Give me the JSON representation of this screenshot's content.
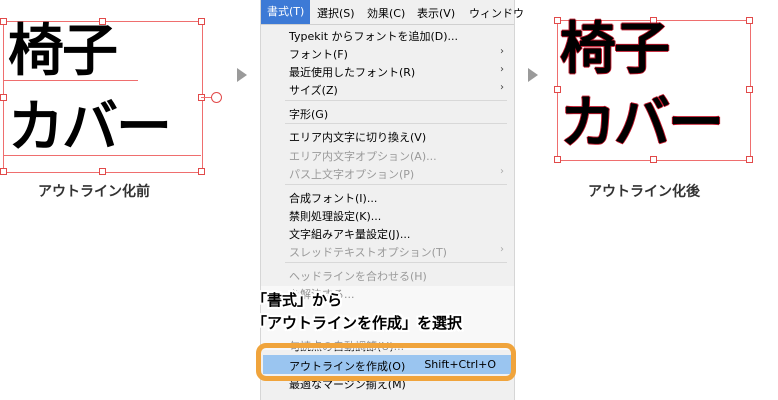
{
  "before": {
    "line1": "椅子",
    "line2": "カバー",
    "caption": "アウトライン化前"
  },
  "after": {
    "line1": "椅子",
    "line2": "カバー",
    "caption": "アウトライン化後"
  },
  "colors": {
    "selection": "#ef6e6e",
    "highlight": "#9ac5f0",
    "callout": "#f0a43c",
    "arrow": "#9a9a9a"
  },
  "menubar": [
    "書式(T)",
    "選択(S)",
    "効果(C)",
    "表示(V)",
    "ウィンドウ"
  ],
  "menu": [
    {
      "label": "Typekit からフォントを追加(D)...",
      "disabled": false,
      "submenu": false
    },
    {
      "label": "フォント(F)",
      "disabled": false,
      "submenu": true
    },
    {
      "label": "最近使用したフォント(R)",
      "disabled": false,
      "submenu": true
    },
    {
      "label": "サイズ(Z)",
      "disabled": false,
      "submenu": true
    },
    {
      "label": "字形(G)",
      "disabled": false,
      "submenu": false
    },
    {
      "label": "エリア内文字に切り換え(V)",
      "disabled": false,
      "submenu": false
    },
    {
      "label": "エリア内文字オプション(A)...",
      "disabled": true,
      "submenu": false
    },
    {
      "label": "パス上文字オプション(P)",
      "disabled": true,
      "submenu": true
    },
    {
      "label": "合成フォント(I)...",
      "disabled": false,
      "submenu": false
    },
    {
      "label": "禁則処理設定(K)...",
      "disabled": false,
      "submenu": false
    },
    {
      "label": "文字組みアキ量設定(J)...",
      "disabled": false,
      "submenu": false
    },
    {
      "label": "スレッドテキストオプション(T)",
      "disabled": true,
      "submenu": true
    },
    {
      "label": "ヘッドラインを合わせる(H)",
      "disabled": true,
      "submenu": false
    },
    {
      "label": "を解決する...",
      "disabled": false,
      "submenu": false
    },
    {
      "label": "句読点の自動調節(U)...",
      "disabled": false,
      "submenu": false
    },
    {
      "label": "アウトラインを作成(O)",
      "disabled": false,
      "submenu": false,
      "shortcut": "Shift+Ctrl+O",
      "highlighted": true
    },
    {
      "label": "最適なマージン揃え(M)",
      "disabled": false,
      "submenu": false
    }
  ],
  "annotation": {
    "line1": "「書式」から",
    "line2": "「アウトラインを作成」を選択"
  }
}
